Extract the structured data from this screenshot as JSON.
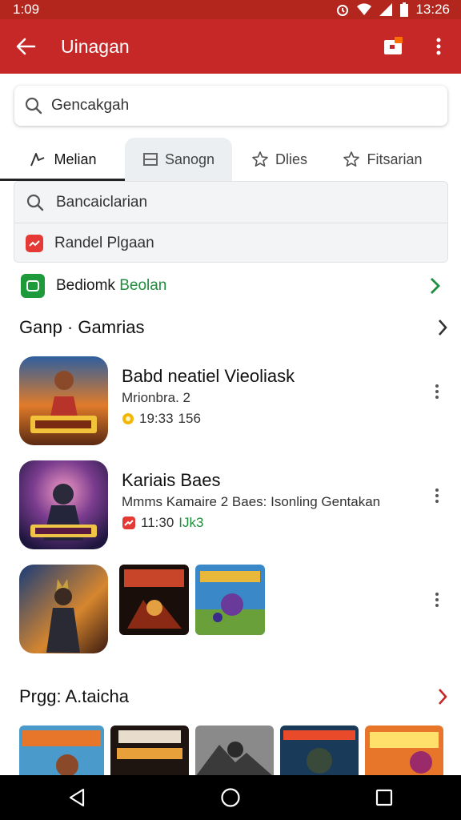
{
  "status_bar": {
    "time_left": "1:09",
    "time_right": "13:26"
  },
  "app_bar": {
    "title": "Uinagan"
  },
  "search": {
    "value": "Gencakgah"
  },
  "tabs": [
    {
      "label": "Melian",
      "icon": "controller-icon"
    },
    {
      "label": "Sanogn",
      "icon": "window-icon"
    },
    {
      "label": "Dlies",
      "icon": "star-icon"
    },
    {
      "label": "Fitsarian",
      "icon": "star-icon"
    }
  ],
  "dropdown": [
    {
      "label": "Bancaiclarian",
      "icon": "search-icon"
    },
    {
      "label": "Randel Plgaan",
      "icon": "red-app-icon"
    }
  ],
  "promo": {
    "label": "Bediomk",
    "highlight": "Beolan"
  },
  "section1": {
    "title": "Ganp · Gamrias"
  },
  "games": [
    {
      "title": "Babd neatiel Vieoliask",
      "subtitle": "Mrionbra. 2",
      "meta1": "19:33",
      "meta2": "156",
      "badge_color": "#f2b705"
    },
    {
      "title": "Kariais Baes",
      "subtitle": "Mmms Kamaire 2 Baes: Isonling Gentakan",
      "meta1": "11:30",
      "meta2": "IJk3",
      "badge_color": "#e53935"
    }
  ],
  "section2": {
    "title": "Prgg: A.taicha"
  },
  "colors": {
    "appbar": "#c62828",
    "statusbar": "#b3261e",
    "accent_green": "#1e8e3e",
    "accent_red": "#e53935"
  }
}
